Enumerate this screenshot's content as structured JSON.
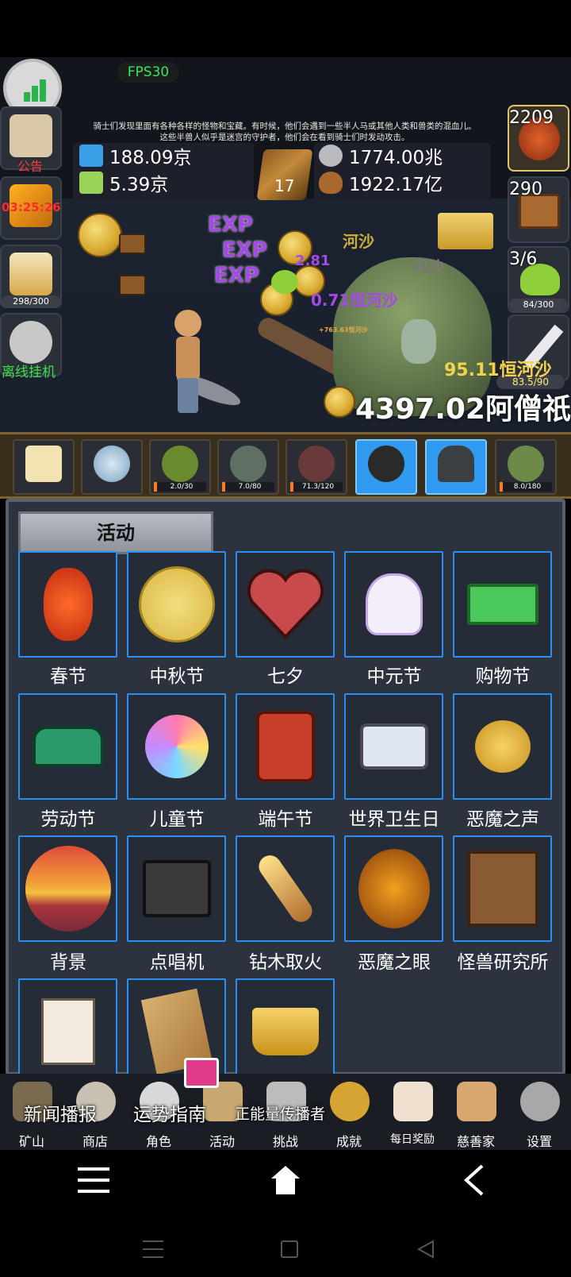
{
  "hud": {
    "fps": "FPS30",
    "story_line1": "骑士们发现里面有各种各样的怪物和宝藏。有时候，他们会遇到一些半人马或其他人类和兽类的混血儿。",
    "story_line2": "这些半兽人似乎是迷宫的守护者，他们会在看到骑士们时发动攻击。",
    "resources": {
      "blue_potion": "188.09京",
      "green_potion": "5.39京",
      "book_count": "17",
      "silver_coin": "1774.00兆",
      "nut": "1922.17亿"
    },
    "left_buttons": {
      "notice_label": "公告",
      "timer_label": "03:25:26",
      "beer_progress": "298/300",
      "offline_label": "离线挂机"
    },
    "right_buttons": {
      "potion_count": "2209",
      "chest_count": "290",
      "slime_ratio": "3/6",
      "slime_progress": "84/300",
      "sword_progress": "83.5/90"
    },
    "battle": {
      "total_gold": "4397.02阿僧祇",
      "dps": "95.11恒河沙",
      "damage_a": "0.71恒河沙",
      "damage_b": "2.81",
      "damage_c": "河沙",
      "exp_label": "EXP",
      "small_dmg": "+763.63恒河沙"
    }
  },
  "monsters": [
    {
      "name": "candle",
      "progress": ""
    },
    {
      "name": "egg",
      "progress": ""
    },
    {
      "name": "slime",
      "progress": "2.0/30"
    },
    {
      "name": "zombie",
      "progress": "7.0/80"
    },
    {
      "name": "bat",
      "progress": "71.3/120"
    },
    {
      "name": "spider",
      "progress": ""
    },
    {
      "name": "reaper",
      "progress": ""
    },
    {
      "name": "orc",
      "progress": "8.0/180"
    }
  ],
  "panel": {
    "title": "活动",
    "tiles": [
      {
        "label": "春节",
        "icon": "lantern-icon"
      },
      {
        "label": "中秋节",
        "icon": "moon-icon"
      },
      {
        "label": "七夕",
        "icon": "heart-icon"
      },
      {
        "label": "中元节",
        "icon": "ghost-icon"
      },
      {
        "label": "购物节",
        "icon": "money-icon"
      },
      {
        "label": "劳动节",
        "icon": "brush-icon"
      },
      {
        "label": "儿童节",
        "icon": "lollipop-icon"
      },
      {
        "label": "端午节",
        "icon": "dragon-mask-icon"
      },
      {
        "label": "世界卫生日",
        "icon": "ambulance-icon"
      },
      {
        "label": "恶魔之声",
        "icon": "bell-bow-icon"
      },
      {
        "label": "背景",
        "icon": "sunset-icon"
      },
      {
        "label": "点唱机",
        "icon": "cassette-icon"
      },
      {
        "label": "钻木取火",
        "icon": "torch-stick-icon"
      },
      {
        "label": "恶魔之眼",
        "icon": "demon-eye-icon"
      },
      {
        "label": "怪兽研究所",
        "icon": "lab-crate-icon"
      },
      {
        "label": "",
        "icon": "papers-icon"
      },
      {
        "label": "",
        "icon": "map-icon"
      },
      {
        "label": "",
        "icon": "crown-icon"
      }
    ]
  },
  "news": {
    "item1": "新闻播报",
    "item2": "运势指南",
    "item3": "正能量传播者"
  },
  "nav": [
    {
      "label": "矿山"
    },
    {
      "label": "商店"
    },
    {
      "label": "角色"
    },
    {
      "label": "活动"
    },
    {
      "label": "挑战"
    },
    {
      "label": "成就"
    },
    {
      "label": "每日奖励"
    },
    {
      "label": "慈善家"
    },
    {
      "label": "设置"
    }
  ],
  "colors": {
    "accent_blue": "#2a8ff2",
    "fps_green": "#3ee06a",
    "timer_red": "#ff2a2a",
    "offline_green": "#39e04a",
    "notice_red": "#ff3a3a"
  }
}
